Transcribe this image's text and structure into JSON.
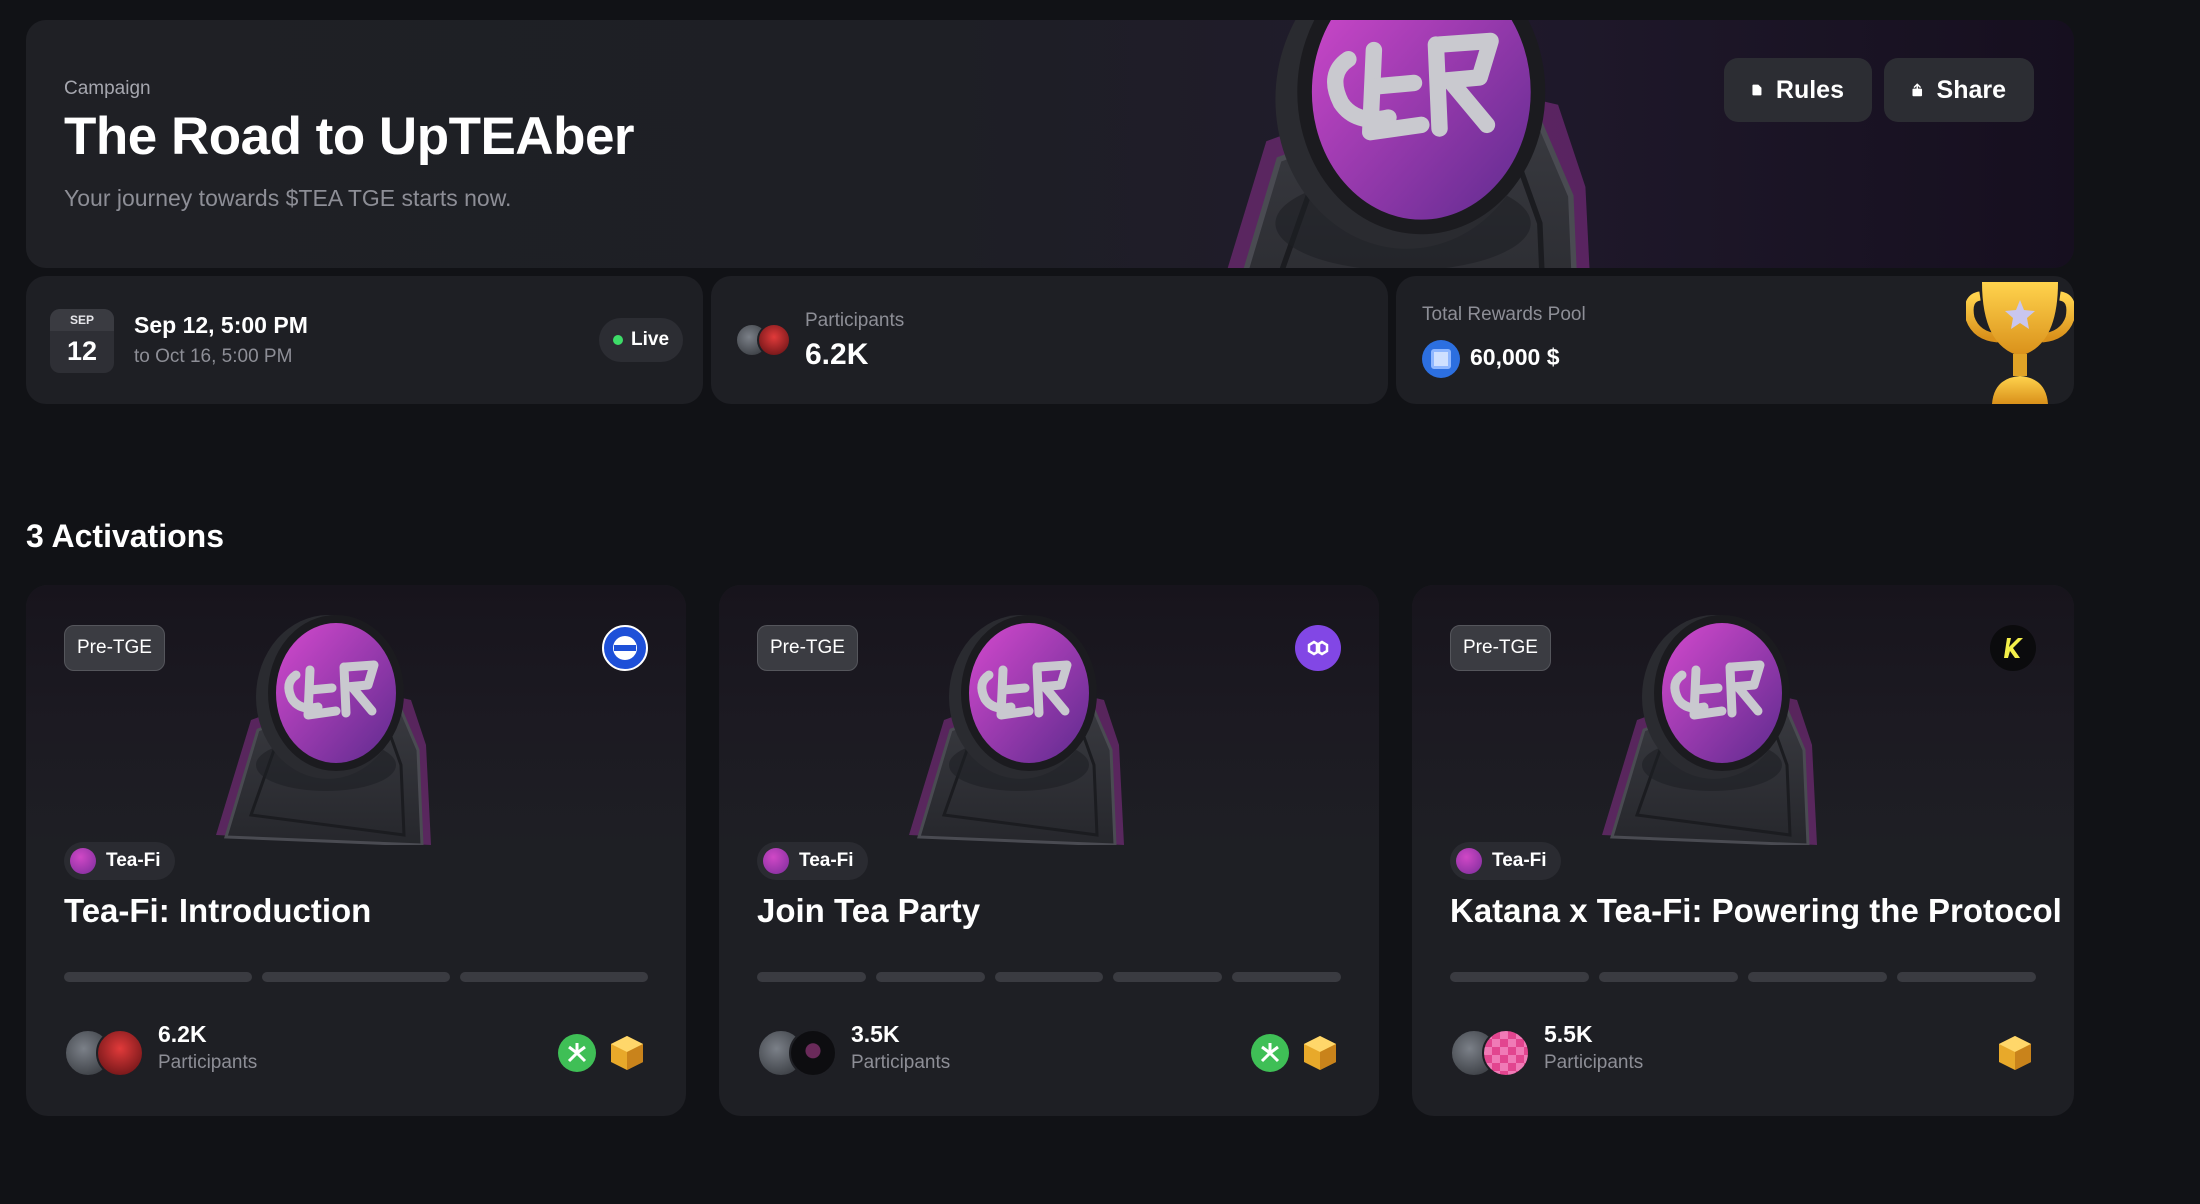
{
  "hero": {
    "label": "Campaign",
    "title": "The Road to UpTEAber",
    "subtitle": "Your journey towards $TEA TGE starts now.",
    "rules_label": "Rules",
    "share_label": "Share"
  },
  "schedule": {
    "month": "SEP",
    "day": "12",
    "start": "Sep 12, 5:00 PM",
    "end": "to Oct 16, 5:00 PM",
    "status": "Live"
  },
  "participants": {
    "label": "Participants",
    "value": "6.2K"
  },
  "rewards_pool": {
    "label": "Total Rewards Pool",
    "value": "60,000 $",
    "icon": "coin-icon"
  },
  "activations": {
    "title": "3 Activations",
    "cards": [
      {
        "badge": "Pre-TGE",
        "chain_icon": "chain-blue-icon",
        "brand": "Tea-Fi",
        "title": "Tea-Fi: Introduction",
        "steps": 3,
        "count": "6.2K",
        "count_label": "Participants",
        "reward_icons": [
          "green-token-icon",
          "gold-cube-icon"
        ]
      },
      {
        "badge": "Pre-TGE",
        "chain_icon": "polygon-icon",
        "brand": "Tea-Fi",
        "title": "Join Tea Party",
        "steps": 5,
        "count": "3.5K",
        "count_label": "Participants",
        "reward_icons": [
          "green-token-icon",
          "gold-cube-icon"
        ]
      },
      {
        "badge": "Pre-TGE",
        "chain_icon": "katana-icon",
        "brand": "Tea-Fi",
        "title": "Katana x Tea-Fi: Powering the Protocol",
        "steps": 4,
        "count": "5.5K",
        "count_label": "Participants",
        "reward_icons": [
          "gold-cube-icon"
        ]
      }
    ]
  },
  "colors": {
    "background": "#111216",
    "card": "#1e1f24",
    "accent_magenta": "#c23ac0",
    "live_green": "#3ddc68"
  }
}
